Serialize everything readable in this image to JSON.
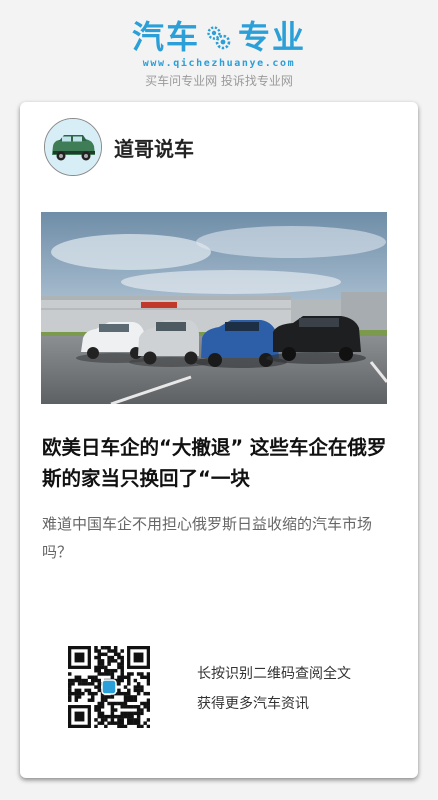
{
  "brand": {
    "name": "汽车专业",
    "name_left": "汽车",
    "name_right": "专业",
    "url": "www.qichezhuanye.com",
    "slogan": "买车问专业网 投诉找专业网"
  },
  "author": {
    "name": "道哥说车"
  },
  "article": {
    "title": "欧美日车企的“大撤退” 这些车企在俄罗斯的家当只换回了“一块",
    "summary": "难道中国车企不用担心俄罗斯日益收缩的汽车市场吗？"
  },
  "qr": {
    "caption_line1": "长按识别二维码查阅全文",
    "caption_line2": "获得更多汽车资讯"
  },
  "colors": {
    "brand_blue": "#2b9fd8",
    "background": "#f3f3f3",
    "card": "#ffffff"
  }
}
